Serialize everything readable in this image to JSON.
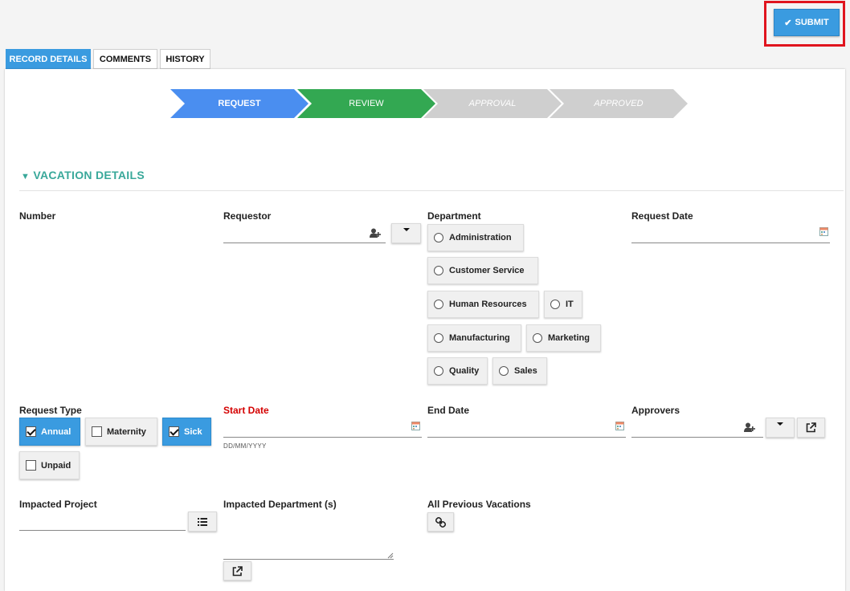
{
  "toolbar": {
    "submit_label": "SUBMIT"
  },
  "tabs": [
    {
      "label": "RECORD DETAILS",
      "active": true
    },
    {
      "label": "COMMENTS",
      "active": false
    },
    {
      "label": "HISTORY",
      "active": false
    }
  ],
  "steps": [
    {
      "label": "REQUEST",
      "state": "current"
    },
    {
      "label": "REVIEW",
      "state": "done"
    },
    {
      "label": "APPROVAL",
      "state": "pending"
    },
    {
      "label": "APPROVED",
      "state": "pending"
    }
  ],
  "section": {
    "title": "VACATION DETAILS"
  },
  "fields": {
    "number": {
      "label": "Number"
    },
    "requestor": {
      "label": "Requestor",
      "value": ""
    },
    "department": {
      "label": "Department",
      "options": [
        "Administration",
        "Customer Service",
        "Human Resources",
        "IT",
        "Manufacturing",
        "Marketing",
        "Quality",
        "Sales"
      ]
    },
    "request_date": {
      "label": "Request Date",
      "value": ""
    },
    "request_type": {
      "label": "Request Type",
      "options": [
        {
          "label": "Annual",
          "checked": true
        },
        {
          "label": "Maternity",
          "checked": false
        },
        {
          "label": "Sick",
          "checked": true
        },
        {
          "label": "Unpaid",
          "checked": false
        }
      ]
    },
    "start_date": {
      "label": "Start Date",
      "hint": "DD/MM/YYYY",
      "value": ""
    },
    "end_date": {
      "label": "End Date",
      "value": ""
    },
    "approvers": {
      "label": "Approvers",
      "value": ""
    },
    "impacted_project": {
      "label": "Impacted Project",
      "value": ""
    },
    "impacted_departments": {
      "label": "Impacted Department (s)",
      "value": ""
    },
    "previous_vacations": {
      "label": "All Previous Vacations"
    }
  },
  "colors": {
    "accent": "#3a9be0",
    "step_current": "#4a8ef0",
    "step_done": "#33a852",
    "step_pending": "#cfcfcf",
    "section_title": "#39a89a",
    "required": "#d40000",
    "highlight": "#e0141e"
  }
}
